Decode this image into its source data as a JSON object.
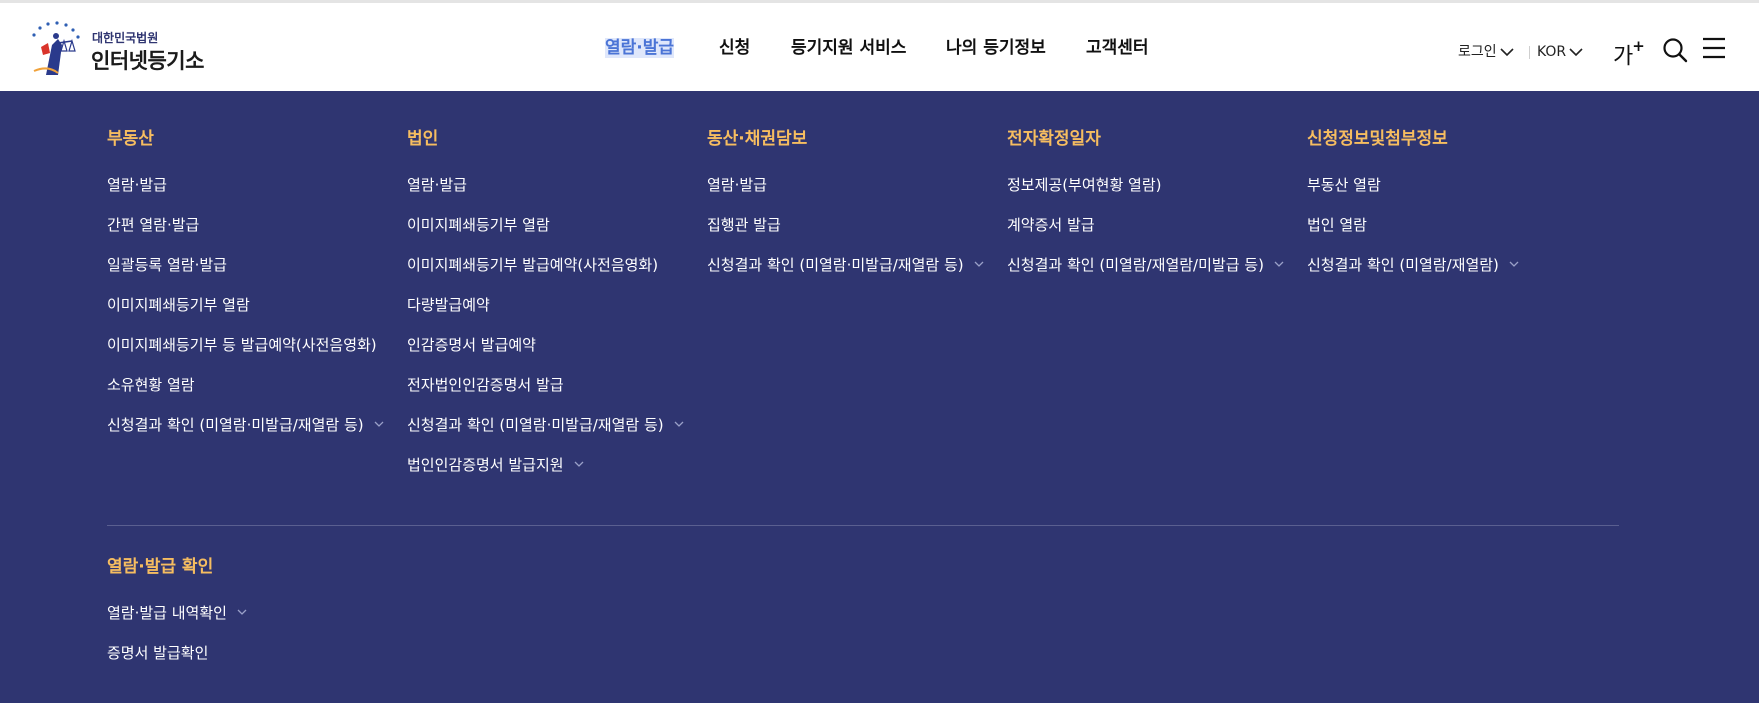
{
  "logo": {
    "small_text": "대한민국법원",
    "big_text": "인터넷등기소"
  },
  "gnb": [
    {
      "label": "열람·발급",
      "active": true
    },
    {
      "label": "신청",
      "active": false
    },
    {
      "label": "등기지원 서비스",
      "active": false
    },
    {
      "label": "나의 등기정보",
      "active": false
    },
    {
      "label": "고객센터",
      "active": false
    }
  ],
  "util": {
    "login_label": "로그인",
    "language_label": "KOR",
    "font_size_label": "가",
    "font_size_plus": "+"
  },
  "icons": {
    "search": "search-icon",
    "menu": "hamburger-menu-icon",
    "dropdown": "chevron-down-icon"
  },
  "colors": {
    "accent": "#f6bd60",
    "panel_bg": "#2f3571",
    "active_menu": "#4b74d6"
  },
  "columns": [
    {
      "title": "부동산",
      "items": [
        {
          "label": "열람·발급",
          "has_sub": false
        },
        {
          "label": "간편 열람·발급",
          "has_sub": false
        },
        {
          "label": "일괄등록 열람·발급",
          "has_sub": false
        },
        {
          "label": "이미지폐쇄등기부 열람",
          "has_sub": false
        },
        {
          "label": "이미지폐쇄등기부 등 발급예약(사전음영화)",
          "has_sub": false
        },
        {
          "label": "소유현황 열람",
          "has_sub": false
        },
        {
          "label": "신청결과 확인 (미열람·미발급/재열람 등)",
          "has_sub": true
        }
      ]
    },
    {
      "title": "법인",
      "items": [
        {
          "label": "열람·발급",
          "has_sub": false
        },
        {
          "label": "이미지폐쇄등기부 열람",
          "has_sub": false
        },
        {
          "label": "이미지폐쇄등기부 발급예약(사전음영화)",
          "has_sub": false
        },
        {
          "label": "다량발급예약",
          "has_sub": false
        },
        {
          "label": "인감증명서 발급예약",
          "has_sub": false
        },
        {
          "label": "전자법인인감증명서 발급",
          "has_sub": false
        },
        {
          "label": "신청결과 확인 (미열람·미발급/재열람 등)",
          "has_sub": true
        },
        {
          "label": "법인인감증명서 발급지원",
          "has_sub": true
        }
      ]
    },
    {
      "title": "동산·채권담보",
      "items": [
        {
          "label": "열람·발급",
          "has_sub": false
        },
        {
          "label": "집행관 발급",
          "has_sub": false
        },
        {
          "label": "신청결과 확인 (미열람·미발급/재열람 등)",
          "has_sub": true
        }
      ]
    },
    {
      "title": "전자확정일자",
      "items": [
        {
          "label": "정보제공(부여현황 열람)",
          "has_sub": false
        },
        {
          "label": "계약증서 발급",
          "has_sub": false
        },
        {
          "label": "신청결과 확인 (미열람/재열람/미발급 등)",
          "has_sub": true
        }
      ]
    },
    {
      "title": "신청정보및첨부정보",
      "items": [
        {
          "label": "부동산 열람",
          "has_sub": false
        },
        {
          "label": "법인 열람",
          "has_sub": false
        },
        {
          "label": "신청결과 확인 (미열람/재열람)",
          "has_sub": true
        }
      ]
    }
  ],
  "bottom_section": {
    "title": "열람·발급 확인",
    "items": [
      {
        "label": "열람·발급 내역확인",
        "has_sub": true
      },
      {
        "label": "증명서 발급확인",
        "has_sub": false
      }
    ]
  }
}
